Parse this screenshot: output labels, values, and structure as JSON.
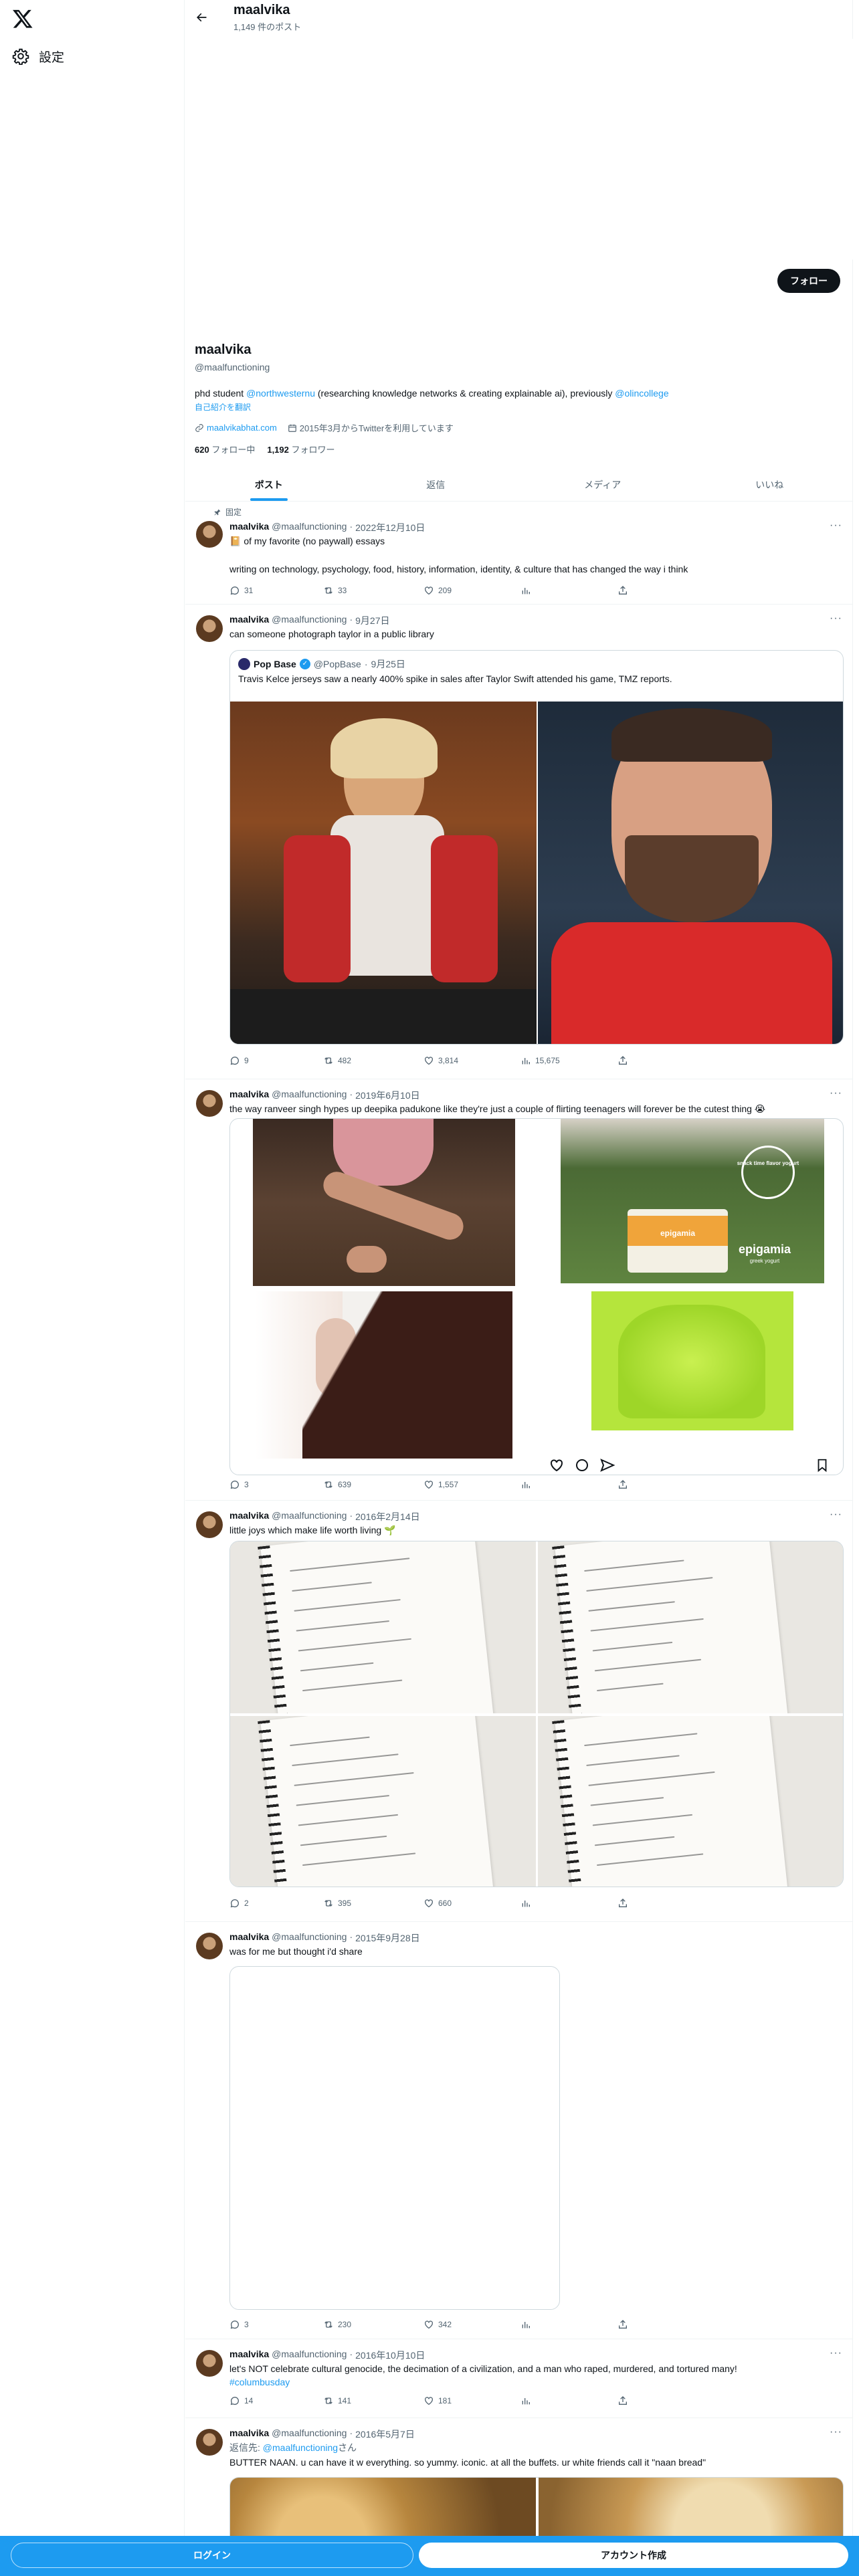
{
  "nav": {
    "settings_label": "設定"
  },
  "header": {
    "name": "maalvika",
    "post_count": "1,149 件のポスト"
  },
  "profile": {
    "name": "maalvika",
    "handle": "@maalfunctioning",
    "follow_label": "フォロー",
    "bio_prefix": "phd student ",
    "bio_link1": "@northwesternu",
    "bio_mid": " (researching knowledge networks & creating explainable ai), previously ",
    "bio_link2": "@olincollege",
    "translate_label": "自己紹介を翻訳",
    "website": "maalvikabhat.com",
    "joined": "2015年3月からTwitterを利用しています",
    "following_count": "620",
    "following_label": "フォロー中",
    "followers_count": "1,192",
    "followers_label": "フォロワー"
  },
  "tabs": [
    {
      "label": "ポスト"
    },
    {
      "label": "返信"
    },
    {
      "label": "メディア"
    },
    {
      "label": "いいね"
    }
  ],
  "tweets": [
    {
      "pinned_label": "固定",
      "name": "maalvika",
      "handle": "@maalfunctioning",
      "date": "2022年12月10日",
      "text1": "📔 of my favorite (no paywall) essays",
      "text2": "writing on technology, psychology, food, history, information, identity, & culture that has changed the way i think",
      "replies": "31",
      "reposts": "33",
      "likes": "209"
    },
    {
      "name": "maalvika",
      "handle": "@maalfunctioning",
      "date": "9月27日",
      "text": "can someone photograph taylor in a public library",
      "quote": {
        "name": "Pop Base",
        "handle": "@PopBase",
        "date": "9月25日",
        "text": "Travis Kelce jerseys saw a nearly 400% spike in sales after Taylor Swift attended his game, TMZ reports."
      },
      "replies": "9",
      "reposts": "482",
      "likes": "3,814",
      "views": "15,675"
    },
    {
      "name": "maalvika",
      "handle": "@maalfunctioning",
      "date": "2019年6月10日",
      "text": "the way ranveer singh hypes up deepika padukone like they're just a couple of flirting teenagers will forever be the cutest thing 😭",
      "ad_text1": "snack time flavor yogurt",
      "ad_text2": "epigamia",
      "ad_text3": "epigamia",
      "ad_text4": "greek yogurt",
      "replies": "3",
      "reposts": "639",
      "likes": "1,557"
    },
    {
      "name": "maalvika",
      "handle": "@maalfunctioning",
      "date": "2016年2月14日",
      "text": "little joys which make life worth living 🌱",
      "replies": "2",
      "reposts": "395",
      "likes": "660"
    },
    {
      "name": "maalvika",
      "handle": "@maalfunctioning",
      "date": "2015年9月28日",
      "text": "was for me but thought i'd share",
      "replies": "3",
      "reposts": "230",
      "likes": "342"
    },
    {
      "name": "maalvika",
      "handle": "@maalfunctioning",
      "date": "2016年10月10日",
      "text": "let's NOT celebrate cultural genocide, the decimation of a civilization, and a man who raped, murdered, and tortured many!",
      "hashtag": "#columbusday",
      "replies": "14",
      "reposts": "141",
      "likes": "181"
    },
    {
      "name": "maalvika",
      "handle": "@maalfunctioning",
      "date": "2016年5月7日",
      "reply_prefix": "返信先: ",
      "reply_to": "@maalfunctioning",
      "reply_suffix": "さん",
      "text": "BUTTER NAAN. u can have it w everything. so yummy. iconic. at all the buffets. ur white friends call it \"naan bread\""
    }
  ],
  "bottom": {
    "login_label": "ログイン",
    "signup_label": "アカウント作成"
  }
}
